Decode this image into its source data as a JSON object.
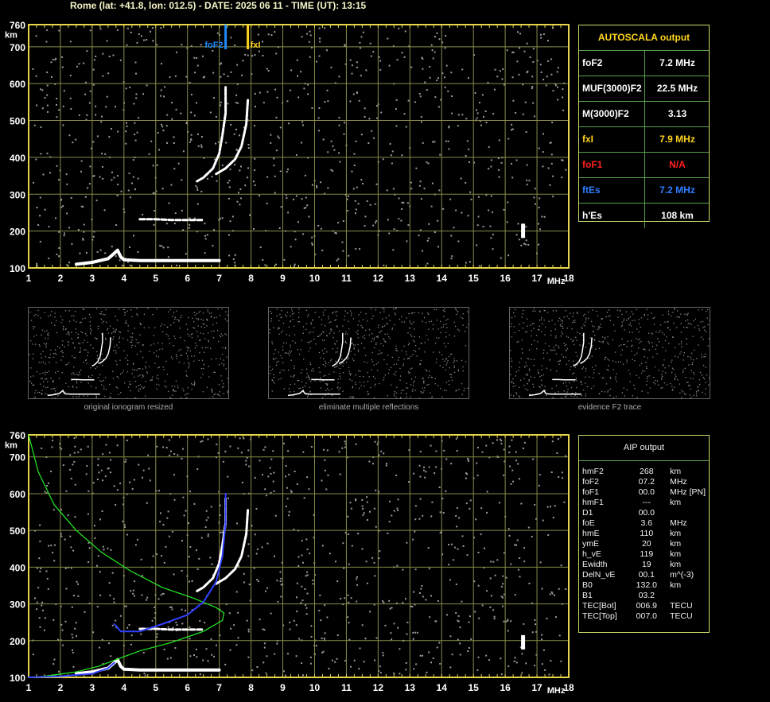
{
  "header": {
    "text": "Rome (lat: +41.8, lon: 012.5) - DATE: 2025 06 11 - TIME (UT): 13:15"
  },
  "colors": {
    "axis": "#e6d54a",
    "grid": "#8a8a4a",
    "trace": "#ffffff",
    "profile": "#22ee22",
    "reconstruction": "#3040ff",
    "foF2_marker": "#1e8cff",
    "fxI_marker": "#ffd21f",
    "noise": "#9a9a9a"
  },
  "ionogram": {
    "x_unit": "MHz",
    "y_unit": "km",
    "x_ticks": [
      "1",
      "2",
      "3",
      "4",
      "5",
      "6",
      "7",
      "8",
      "9",
      "10",
      "11",
      "12",
      "13",
      "14",
      "15",
      "16",
      "17",
      "18"
    ],
    "y_ticks": [
      "100",
      "200",
      "300",
      "400",
      "500",
      "600",
      "700",
      "760"
    ],
    "markers": {
      "foF2": "foF2",
      "fxI": "fxI"
    }
  },
  "chart_data": [
    {
      "type": "scatter",
      "title": "",
      "xlabel": "MHz",
      "ylabel": "km",
      "xlim": [
        1,
        18
      ],
      "ylim": [
        100,
        760
      ],
      "grid": true,
      "series": [
        {
          "name": "",
          "points": [
            [
              2.5,
              110
            ],
            [
              3,
              115
            ],
            [
              3.5,
              125
            ],
            [
              3.7,
              140
            ],
            [
              3.8,
              148
            ],
            [
              3.9,
              130
            ],
            [
              4,
              122
            ],
            [
              4.5,
              120
            ],
            [
              5,
              120
            ],
            [
              5.5,
              120
            ],
            [
              6,
              120
            ],
            [
              6.5,
              120
            ],
            [
              7,
              120
            ]
          ]
        },
        {
          "name": "",
          "points": [
            [
              4.5,
              232
            ],
            [
              5,
              232
            ],
            [
              5.5,
              230
            ],
            [
              6,
              230
            ],
            [
              6.5,
              230
            ]
          ]
        },
        {
          "name": "",
          "points": [
            [
              6.3,
              335
            ],
            [
              6.5,
              345
            ],
            [
              6.8,
              370
            ],
            [
              7,
              410
            ],
            [
              7.1,
              460
            ],
            [
              7.2,
              520
            ],
            [
              7.2,
              590
            ]
          ]
        },
        {
          "name": "",
          "points": [
            [
              6.9,
              355
            ],
            [
              7.2,
              370
            ],
            [
              7.5,
              395
            ],
            [
              7.7,
              430
            ],
            [
              7.85,
              490
            ],
            [
              7.9,
              555
            ]
          ]
        }
      ],
      "markers": [
        {
          "label": "foF2",
          "x": 7.2
        },
        {
          "label": "fxI",
          "x": 7.9
        }
      ]
    },
    {
      "type": "line",
      "title": "",
      "xlabel": "MHz",
      "ylabel": "km",
      "xlim": [
        1,
        18
      ],
      "ylim": [
        100,
        760
      ],
      "grid": true,
      "series": [
        {
          "name": "",
          "points": [
            [
              1,
              760
            ],
            [
              1.3,
              660
            ],
            [
              1.8,
              570
            ],
            [
              2.5,
              500
            ],
            [
              3.3,
              440
            ],
            [
              4.2,
              390
            ],
            [
              5.2,
              345
            ],
            [
              6.2,
              315
            ],
            [
              6.9,
              290
            ],
            [
              7.15,
              275
            ],
            [
              7.1,
              255
            ],
            [
              6.5,
              225
            ],
            [
              5.5,
              195
            ],
            [
              4.5,
              172
            ],
            [
              3.8,
              150
            ],
            [
              3.2,
              130
            ],
            [
              2.5,
              115
            ],
            [
              1.5,
              103
            ],
            [
              1,
              100
            ]
          ]
        },
        {
          "name": "",
          "points": [
            [
              3.7,
              245
            ],
            [
              3.9,
              225
            ],
            [
              4.5,
              225
            ],
            [
              5.2,
              245
            ],
            [
              6,
              270
            ],
            [
              6.5,
              305
            ],
            [
              6.9,
              360
            ],
            [
              7.1,
              430
            ],
            [
              7.2,
              520
            ],
            [
              7.2,
              600
            ]
          ]
        },
        {
          "name": "",
          "points": [
            [
              1,
              100
            ],
            [
              2,
              103
            ],
            [
              3,
              110
            ],
            [
              3.5,
              125
            ],
            [
              3.7,
              140
            ]
          ]
        }
      ],
      "markers": []
    }
  ],
  "autoscala": {
    "title": "AUTOSCALA output",
    "rows": [
      {
        "label": "foF2",
        "value": "7.2 MHz",
        "color": "#ffffff"
      },
      {
        "label": "MUF(3000)F2",
        "value": "22.5 MHz",
        "color": "#ffffff"
      },
      {
        "label": "M(3000)F2",
        "value": "3.13",
        "color": "#ffffff"
      },
      {
        "label": "fxI",
        "value": "7.9 MHz",
        "color": "#ffd21f"
      },
      {
        "label": "foF1",
        "value": "N/A",
        "color": "#ff2020"
      },
      {
        "label": "ftEs",
        "value": "7.2 MHz",
        "color": "#2f7dff"
      },
      {
        "label": "h'Es",
        "value": "108      km",
        "color": "#ffffff"
      }
    ]
  },
  "thumbnails": [
    {
      "caption": "original ionogram resized"
    },
    {
      "caption": "eliminate multiple reflections"
    },
    {
      "caption": "evidence F2 trace"
    }
  ],
  "aip": {
    "title": "AIP output",
    "rows": [
      [
        "hmF2",
        "268",
        "km"
      ],
      [
        "foF2",
        "07.2",
        "MHz"
      ],
      [
        "foF1",
        "00.0",
        "MHz   [PN]"
      ],
      [
        "hmF1",
        "---",
        "km"
      ],
      [
        "D1",
        "00.0",
        ""
      ],
      [
        "foE",
        "3.6",
        "MHz"
      ],
      [
        "hmE",
        "110",
        "km"
      ],
      [
        "ymE",
        "20",
        "km"
      ],
      [
        "h_vE",
        "119",
        "km"
      ],
      [
        "Ewidth",
        "19",
        "km"
      ],
      [
        "DelN_vE",
        "00.1",
        "m^(-3)"
      ],
      [
        "B0",
        "132.0",
        "km"
      ],
      [
        "B1",
        "03.2",
        ""
      ],
      [
        "TEC[Bot]",
        "006.9",
        "TECU"
      ],
      [
        "TEC[Top]",
        "007.0",
        "TECU"
      ]
    ]
  }
}
